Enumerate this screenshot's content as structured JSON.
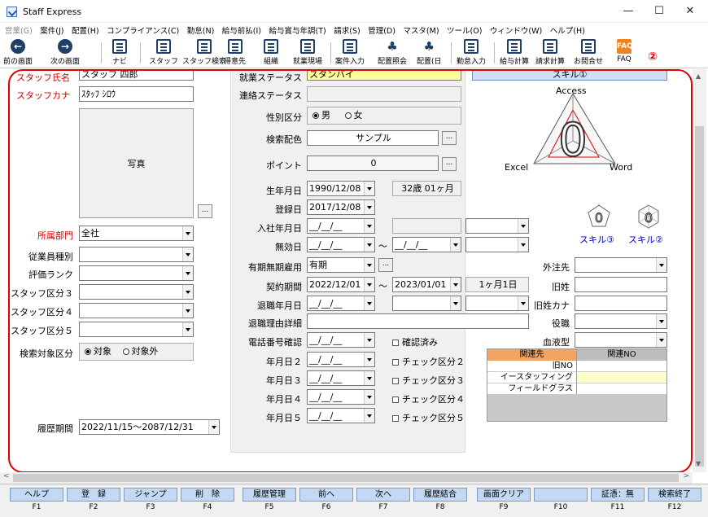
{
  "window": {
    "title": "Staff Express",
    "minimize": "—",
    "maximize": "☐",
    "close": "✕"
  },
  "menu": [
    {
      "label": "営業(G)",
      "disabled": true
    },
    {
      "label": "案件(J)",
      "disabled": false
    },
    {
      "label": "配置(H)",
      "disabled": false
    },
    {
      "label": "コンプライアンス(C)",
      "disabled": false
    },
    {
      "label": "勤怠(N)",
      "disabled": false
    },
    {
      "label": "給与前払(I)",
      "disabled": false
    },
    {
      "label": "給与賞与年調(T)",
      "disabled": false
    },
    {
      "label": "請求(S)",
      "disabled": false
    },
    {
      "label": "管理(D)",
      "disabled": false
    },
    {
      "label": "マスタ(M)",
      "disabled": false
    },
    {
      "label": "ツール(O)",
      "disabled": false
    },
    {
      "label": "ウィンドウ(W)",
      "disabled": false
    },
    {
      "label": "ヘルプ(H)",
      "disabled": false
    }
  ],
  "toolbar": {
    "prev": "前の画面",
    "next": "次の画面",
    "navi": "ナビ",
    "staff": "スタッフ",
    "staff_search": "スタッフ検索",
    "client": "得意先",
    "org": "組織",
    "site": "就業現場",
    "job_entry": "案件入力",
    "assign_query": "配置照会",
    "assign": "配置(日",
    "attendance": "勤怠入力",
    "pay_calc": "給与計算",
    "bill_calc": "請求計算",
    "inquiry": "お問合せ",
    "faq": "FAQ",
    "faq_icon": "FAQ",
    "marker": "②"
  },
  "left": {
    "staff_name_label": "スタッフ氏名",
    "staff_name": "スタッフ 四郎",
    "staff_kana_label": "スタッフカナ",
    "staff_kana": "ｽﾀｯﾌ ｼﾛｳ",
    "photo_label": "写真",
    "photo_btn": "...",
    "dept_label": "所属部門",
    "dept": "全社",
    "emp_type_label": "従業員種別",
    "rank_label": "評価ランク",
    "cat3_label": "スタッフ区分３",
    "cat4_label": "スタッフ区分４",
    "cat5_label": "スタッフ区分５",
    "search_target_label": "検索対象区分",
    "target_on": "対象",
    "target_off": "対象外",
    "history_label": "履歴期間",
    "history": "2022/11/15～2087/12/31"
  },
  "center": {
    "work_status_label": "就業ステータス",
    "work_status": "スタンバイ",
    "contact_status_label": "連絡ステータス",
    "gender_label": "性別区分",
    "male": "男",
    "female": "女",
    "color_label": "検索配色",
    "color": "サンプル",
    "color_btn": "...",
    "point_label": "ポイント",
    "point": "0",
    "point_btn": "...",
    "birth_label": "生年月日",
    "birth": "1990/12/08",
    "age": "32歳 01ヶ月",
    "reg_label": "登録日",
    "reg": "2017/12/08",
    "join_label": "入社年月日",
    "blank_date": "__/__/__",
    "invalid_label": "無効日",
    "tilde": "～",
    "term_label": "有期無期雇用",
    "term": "有期",
    "term_btn": "...",
    "contract_label": "契約期間",
    "contract_from": "2022/12/01",
    "contract_to": "2023/01/01",
    "contract_len": "1ヶ月1日",
    "retire_label": "退職年月日",
    "retire_reason_label": "退職理由詳細",
    "phone_label": "電話番号確認",
    "confirmed": "確認済み",
    "date2_label": "年月日２",
    "date3_label": "年月日３",
    "date4_label": "年月日４",
    "date5_label": "年月日５",
    "check2": "チェック区分２",
    "check3": "チェック区分３",
    "check4": "チェック区分４",
    "check5": "チェック区分５"
  },
  "right": {
    "skill_bar": "スキル①",
    "radar_top": "Access",
    "radar_left": "Excel",
    "radar_right": "Word",
    "radar_value": "0",
    "skill3": "スキル③",
    "skill2": "スキル②",
    "mini_value": "0",
    "outsource_label": "外注先",
    "old_name_label": "旧姓",
    "old_kana_label": "旧姓カナ",
    "position_label": "役職",
    "blood_label": "血液型",
    "rel_header": "関連先",
    "rel_no_header": "関連NO",
    "rel_rows": [
      "旧NO",
      "イースタッフィング",
      "フィールドグラス"
    ]
  },
  "fkeys": [
    {
      "label": "ヘルプ",
      "key": "F1"
    },
    {
      "label": "登　録",
      "key": "F2"
    },
    {
      "label": "ジャンプ",
      "key": "F3"
    },
    {
      "label": "削　除",
      "key": "F4"
    },
    {
      "label": "履歴管理",
      "key": "F5"
    },
    {
      "label": "前へ",
      "key": "F6"
    },
    {
      "label": "次へ",
      "key": "F7"
    },
    {
      "label": "履歴結合",
      "key": "F8"
    },
    {
      "label": "画面クリア",
      "key": "F9"
    },
    {
      "label": "",
      "key": "F10"
    },
    {
      "label": "証憑：無",
      "key": "F11"
    },
    {
      "label": "検索終了",
      "key": "F12"
    }
  ],
  "colors": {
    "accent_red": "#e00000",
    "yellow": "#ffff99",
    "fkey_blue": "#c3d9f3"
  }
}
